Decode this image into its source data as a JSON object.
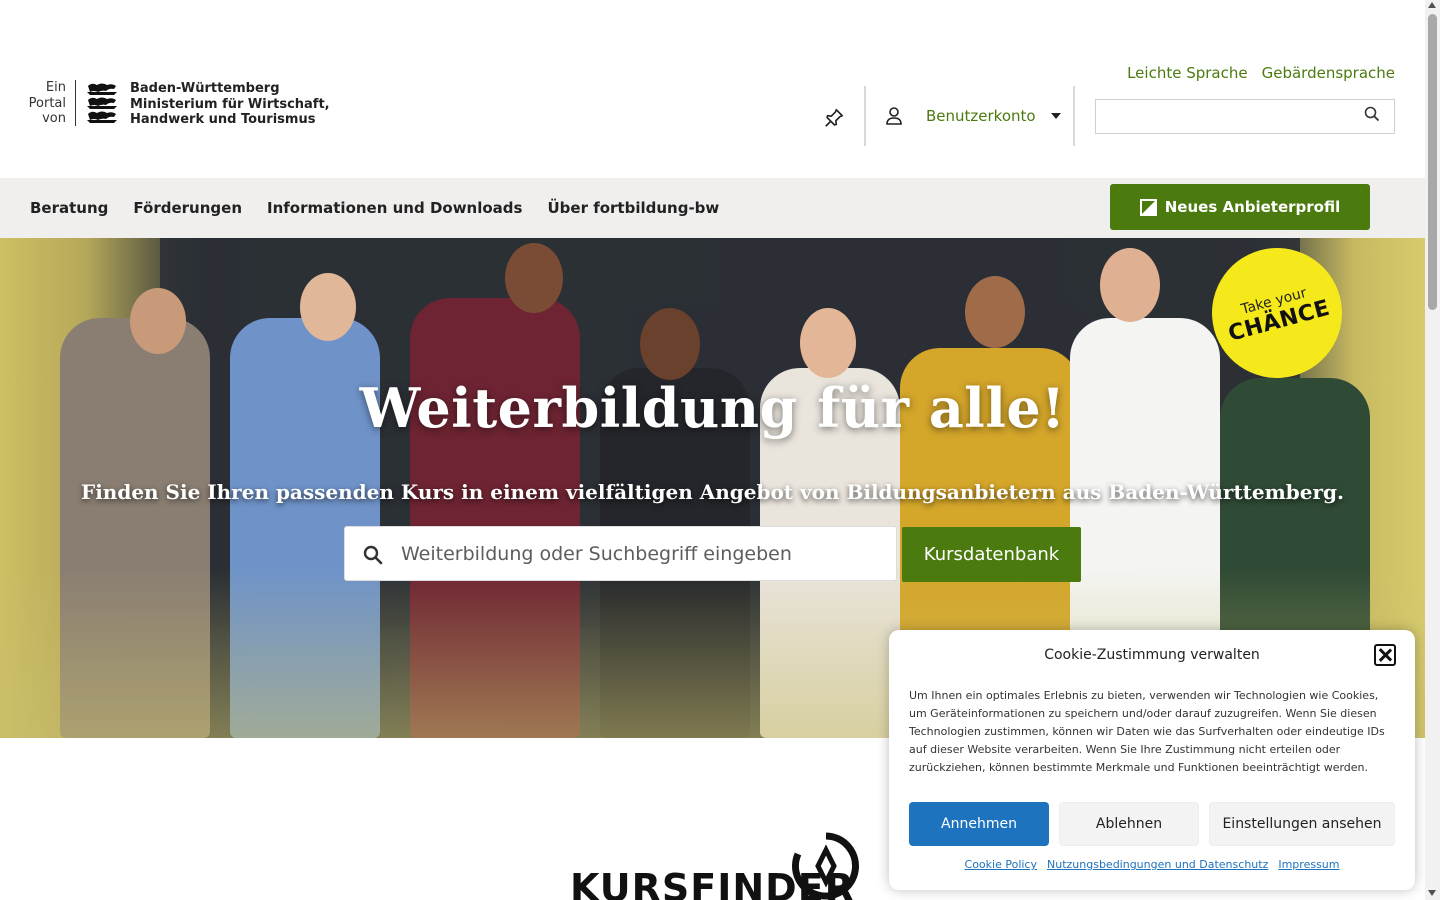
{
  "header": {
    "logo": {
      "portal_text": [
        "Ein",
        "Portal",
        "von"
      ],
      "ministry_lines": [
        "Baden-Württemberg",
        "Ministerium für Wirtschaft,",
        "Handwerk und Tourismus"
      ]
    },
    "top_links": [
      "Leichte Sprache",
      "Gebärdensprache"
    ],
    "account_label": "Benutzerkonto",
    "search_placeholder": ""
  },
  "nav": {
    "items": [
      "Beratung",
      "Förderungen",
      "Informationen und Downloads",
      "Über fortbildung-bw"
    ],
    "cta_label": "Neues Anbieterprofil"
  },
  "hero": {
    "title": "Weiterbildung für alle!",
    "subtitle": "Finden Sie Ihren passenden Kurs in einem vielfältigen Angebot von Bildungsanbietern aus Baden-Württemberg.",
    "search_placeholder": "Weiterbildung oder Suchbegriff eingeben",
    "search_button": "Kursdatenbank",
    "badge_line1": "Take your",
    "badge_line2": "CHÄNCE"
  },
  "kursfinder": {
    "word": "KURSFINDER"
  },
  "cookie": {
    "title": "Cookie-Zustimmung verwalten",
    "text": "Um Ihnen ein optimales Erlebnis zu bieten, verwenden wir Technologien wie Cookies, um Geräteinformationen zu speichern und/oder darauf zuzugreifen. Wenn Sie diesen Technologien zustimmen, können wir Daten wie das Surfverhalten oder eindeutige IDs auf dieser Website verarbeiten. Wenn Sie Ihre Zustimmung nicht erteilen oder zurückziehen, können bestimmte Merkmale und Funktionen beeinträchtigt werden.",
    "accept": "Annehmen",
    "deny": "Ablehnen",
    "preferences": "Einstellungen ansehen",
    "links": [
      "Cookie Policy",
      "Nutzungsbedingungen und Datenschutz",
      "Impressum"
    ]
  },
  "colors": {
    "brand_green": "#4b7a0f",
    "accept_blue": "#1e73be",
    "badge_yellow": "#f5e81b",
    "nav_bg": "#f0efee"
  },
  "icons": [
    "lion-crest-icon",
    "pin-icon",
    "user-icon",
    "chevron-down-icon",
    "search-icon",
    "profile-icon",
    "close-icon",
    "kursfinder-logo-icon"
  ]
}
